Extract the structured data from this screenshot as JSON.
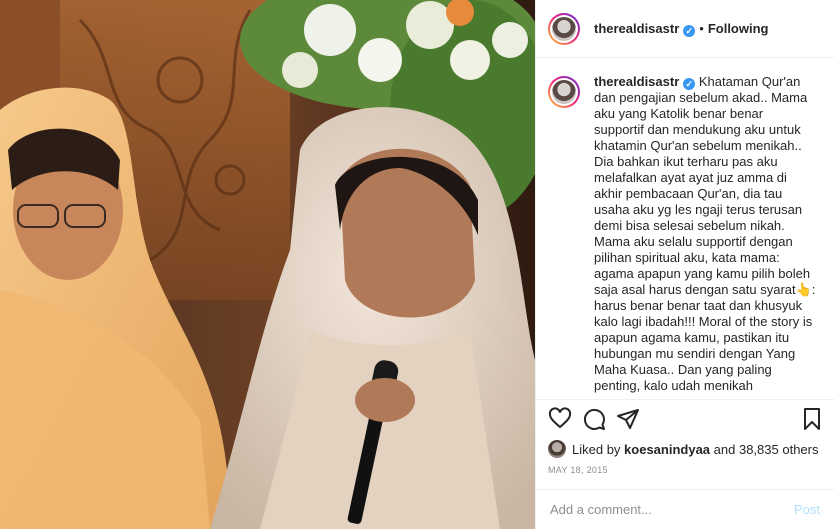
{
  "post": {
    "username": "therealdisastr",
    "follow_status": "Following",
    "separator": "•",
    "verified_mark": "✓"
  },
  "caption": {
    "username": "therealdisastr",
    "text": "Khataman Qur'an dan pengajian sebelum akad.. Mama aku yang Katolik benar benar supportif dan mendukung aku untuk khatamin Qur'an sebelum menikah.. Dia bahkan ikut terharu pas aku melafalkan ayat ayat juz amma di akhir pembacaan Qur'an, dia tau usaha aku yg les ngaji terus terusan demi bisa selesai sebelum nikah. Mama aku selalu supportif dengan pilihan spiritual aku, kata mama: agama apapun yang kamu pilih boleh saja asal harus dengan satu syarat👆: harus benar benar taat dan khusyuk kalo lagi ibadah!!! Moral of the story is apapun agama kamu, pastikan itu hubungan mu sendiri dengan Yang Maha Kuasa.. Dan yang paling penting, kalo udah menikah"
  },
  "actions": {
    "icons": [
      "heart-icon",
      "comment-icon",
      "share-icon",
      "bookmark-icon"
    ]
  },
  "likes": {
    "prefix": "Liked by",
    "user": "koesanindyaa",
    "suffix": "and 38,835 others"
  },
  "date": "MAY 18, 2015",
  "comment_box": {
    "placeholder": "Add a comment...",
    "post_label": "Post"
  },
  "colors": {
    "verified": "#3897f0",
    "post_disabled": "#b2dffc",
    "meta_gray": "#8e8e8e"
  }
}
